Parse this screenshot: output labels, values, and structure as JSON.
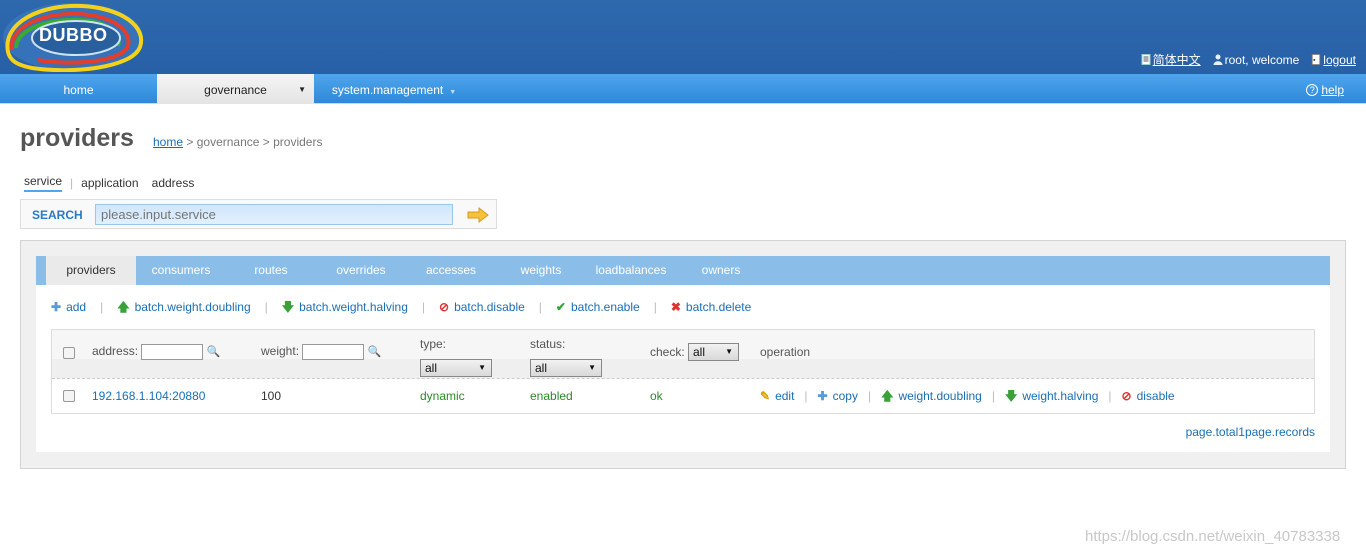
{
  "header": {
    "logo_text": "DUBBO",
    "language_link": "简体中文",
    "welcome_text": "root, welcome",
    "logout_link": "logout"
  },
  "nav": {
    "home": "home",
    "governance": "governance",
    "system_management": "system.management",
    "help": "help"
  },
  "page": {
    "title": "providers",
    "breadcrumb": {
      "home": "home",
      "rest": "> governance > providers"
    }
  },
  "search": {
    "tabs": [
      "service",
      "application",
      "address"
    ],
    "label": "SEARCH",
    "placeholder": "please.input.service"
  },
  "tabs": [
    "providers",
    "consumers",
    "routes",
    "overrides",
    "accesses",
    "weights",
    "loadbalances",
    "owners"
  ],
  "actions": {
    "add": "add",
    "batch_weight_doubling": "batch.weight.doubling",
    "batch_weight_halving": "batch.weight.halving",
    "batch_disable": "batch.disable",
    "batch_enable": "batch.enable",
    "batch_delete": "batch.delete"
  },
  "table": {
    "headers": {
      "address": "address:",
      "weight": "weight:",
      "type": "type:",
      "status": "status:",
      "check": "check:",
      "operation": "operation"
    },
    "filters": {
      "type": "all",
      "status": "all",
      "check": "all"
    },
    "rows": [
      {
        "address": "192.168.1.104:20880",
        "weight": "100",
        "type": "dynamic",
        "status": "enabled",
        "check": "ok",
        "ops": {
          "edit": "edit",
          "copy": "copy",
          "weight_doubling": "weight.doubling",
          "weight_halving": "weight.halving",
          "disable": "disable"
        }
      }
    ]
  },
  "records": "page.total1page.records",
  "watermark": "https://blog.csdn.net/weixin_40783338"
}
